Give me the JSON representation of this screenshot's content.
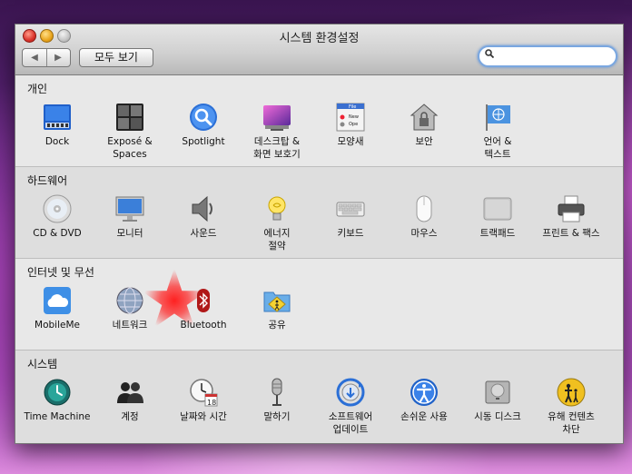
{
  "window": {
    "title": "시스템 환경설정"
  },
  "toolbar": {
    "back_label": "◀",
    "forward_label": "▶",
    "show_all_label": "모두 보기",
    "search_value": ""
  },
  "sections": {
    "personal": {
      "title": "개인",
      "items": [
        "Dock",
        "Exposé &\nSpaces",
        "Spotlight",
        "데스크탑 &\n화면 보호기",
        "모양새",
        "보안",
        "언어 &\n텍스트"
      ]
    },
    "hardware": {
      "title": "하드웨어",
      "items": [
        "CD & DVD",
        "모니터",
        "사운드",
        "에너지\n절약",
        "키보드",
        "마우스",
        "트랙패드",
        "프린트 & 팩스"
      ]
    },
    "internet": {
      "title": "인터넷 및 무선",
      "items": [
        "MobileMe",
        "네트워크",
        "Bluetooth",
        "공유"
      ]
    },
    "system": {
      "title": "시스템",
      "items": [
        "Time Machine",
        "계정",
        "날짜와 시간",
        "말하기",
        "소프트웨어\n업데이트",
        "손쉬운 사용",
        "시동 디스크",
        "유해 컨텐츠\n차단"
      ]
    }
  },
  "icons": {
    "appearance_file_text": "File",
    "appearance_new_text": "New",
    "appearance_open_text": "Ope",
    "calendar_day": "18"
  },
  "colors": {
    "selection_glow": "#ff2020",
    "search_focus": "#7aa7e0"
  }
}
